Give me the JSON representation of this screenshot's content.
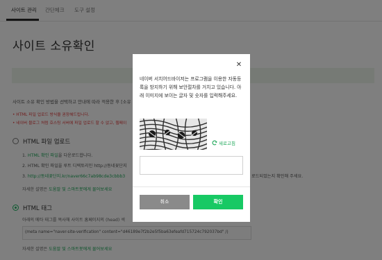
{
  "tabs": [
    {
      "label": "사이트 관리"
    },
    {
      "label": "간단체크"
    },
    {
      "label": "도구 설정"
    }
  ],
  "page_title": "사이트 소유확인",
  "description": "사이트 소유 확인 방법을 선택하고 안내에 따라 적용한 후 [소유",
  "notices": [
    "• HTML 파일 업로드 방식을 권장해드립니다.",
    "• 네이버 블로그 처럼 호스팅 서버에 파일 업로드 할 수 없고, 웹페이"
  ],
  "option_file": {
    "label": "HTML 파일 업로드",
    "step1_num": "1.",
    "step1_link": "HTML 확인 파일",
    "step1_rest": "을 다운로드합니다.",
    "step2": "2. HTML 확인 파일을 루트 디렉토리인 http://동네꽃단지",
    "step3_num": "3.",
    "step3_link": "http://동네꽃단지.kr/naver66c7ab98cde3cbbb3",
    "step3_right": "로드되었는지 확인해 주세요.",
    "more_prefix": "자세한 설명은 ",
    "more_link": "도움말 및 스마트봇에게 물어보세요"
  },
  "option_tag": {
    "label": "HTML 태그",
    "step": "아래의 메타 태그를 복사해 사이트 홈페이지의 (head) 섹",
    "meta": "(meta name=\"naver-site-verification\" content=\"d46189e7f2b2e5f5ba63efeafd715724c792037bd\" /)",
    "more_prefix": "자세한 설명은 ",
    "more_link": "도움말 및 스마트봇에게 물어보세요"
  },
  "modal": {
    "close_icon": "close-icon",
    "message": "네이버 서치어드바이저는 프로그램을 이용한 자동등록을 방지하기 위해 보안절차를 거치고 있습니다. 아래 이미지에 보이는 글자 및 숫자를 입력해주세요.",
    "refresh_label": "새로고침",
    "refresh_icon": "refresh-icon",
    "input_value": "",
    "cancel_label": "취소",
    "confirm_label": "확인"
  },
  "colors": {
    "accent": "#17c964",
    "link": "#1fa85a",
    "warning": "#e03c3c",
    "cancel": "#8a8a8a"
  }
}
